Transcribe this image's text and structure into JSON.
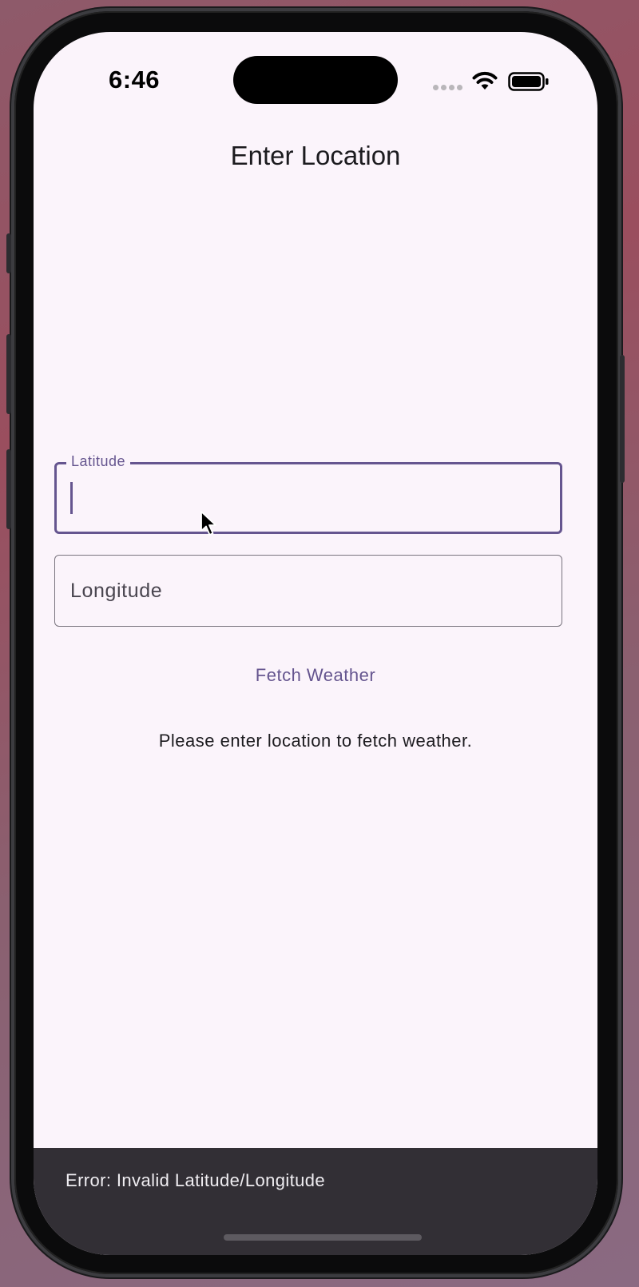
{
  "status_bar": {
    "time": "6:46",
    "icons": [
      "cellular-dots-icon",
      "wifi-icon",
      "battery-icon"
    ]
  },
  "app_bar": {
    "title": "Enter Location"
  },
  "form": {
    "latitude": {
      "label": "Latitude",
      "value": "",
      "focused": true
    },
    "longitude": {
      "label": "Longitude",
      "value": ""
    },
    "fetch_button_label": "Fetch Weather",
    "status_message": "Please enter location to fetch weather."
  },
  "snackbar": {
    "message": "Error: Invalid Latitude/Longitude"
  },
  "colors": {
    "primary": "#65558f",
    "background": "#fbf4fb",
    "snackbar": "#322f35",
    "outline": "#79747e"
  }
}
